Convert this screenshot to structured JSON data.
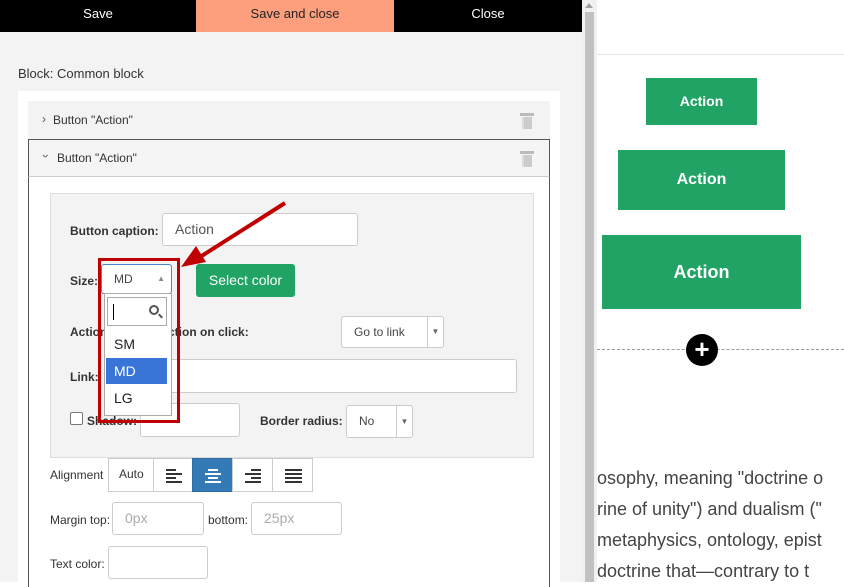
{
  "toolbar": {
    "save_label": "Save",
    "save_close_label": "Save and close",
    "close_label": "Close",
    "save_close_color": "#fd9f7d"
  },
  "block": {
    "title": "Block: Common block"
  },
  "accordion": [
    {
      "label": "Button \"Action\"",
      "expanded": false
    },
    {
      "label": "Button \"Action\"",
      "expanded": true
    }
  ],
  "form": {
    "caption_label": "Button caption:",
    "caption_value": "Action",
    "size_label": "Size:",
    "size_value": "MD",
    "select_color_label": "Select color",
    "action_label": "Action on click:Action on click:",
    "action_value": "Go to link",
    "link_label": "Link:",
    "shadow_label": "Shadow:",
    "border_radius_label": "Border radius:",
    "border_radius_value": "No",
    "alignment_label": "Alignment",
    "alignment_auto": "Auto",
    "margin_top_label": "Margin top:",
    "margin_top_placeholder": "0px",
    "bottom_label": "bottom:",
    "bottom_placeholder": "25px",
    "text_color_label": "Text color:"
  },
  "size_dropdown": {
    "search_value": "",
    "options": [
      "SM",
      "MD",
      "LG"
    ],
    "selected": "MD"
  },
  "preview": {
    "buttons": [
      {
        "size": "SM",
        "label": "Action"
      },
      {
        "size": "MD",
        "label": "Action"
      },
      {
        "size": "LG",
        "label": "Action"
      }
    ],
    "add_symbol": "+",
    "text_lines": [
      "osophy, meaning \"doctrine o",
      "rine of unity\") and dualism (\"",
      " metaphysics, ontology, epist",
      " doctrine that—contrary to t"
    ],
    "accent_color": "#21a366"
  }
}
